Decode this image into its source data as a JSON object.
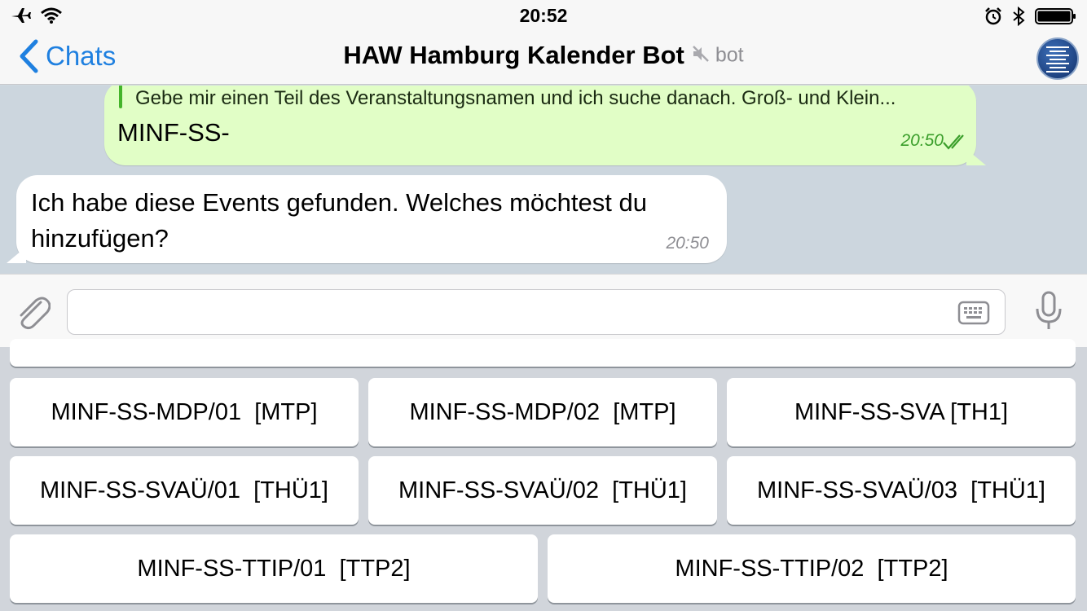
{
  "status_bar": {
    "time": "20:52"
  },
  "nav": {
    "back_label": "Chats",
    "title": "HAW Hamburg Kalender Bot",
    "subtitle": "bot"
  },
  "messages": {
    "outgoing": {
      "reply_preview": "Gebe mir einen Teil des Veranstaltungsnamen und ich suche danach.  Groß- und Klein...",
      "text": "MINF-SS-",
      "time": "20:50"
    },
    "incoming": {
      "text": "Ich habe diese Events gefunden. Welches möchtest du hinzufügen?",
      "time": "20:50"
    }
  },
  "input": {
    "placeholder": ""
  },
  "keyboard": {
    "rows": [
      [
        "MINF-SS-MDP/01  [MTP]",
        "MINF-SS-MDP/02  [MTP]",
        "MINF-SS-SVA [TH1]"
      ],
      [
        "MINF-SS-SVAÜ/01  [THÜ1]",
        "MINF-SS-SVAÜ/02  [THÜ1]",
        "MINF-SS-SVAÜ/03  [THÜ1]"
      ],
      [
        "MINF-SS-TTIP/01  [TTP2]",
        "MINF-SS-TTIP/02  [TTP2]"
      ]
    ]
  }
}
